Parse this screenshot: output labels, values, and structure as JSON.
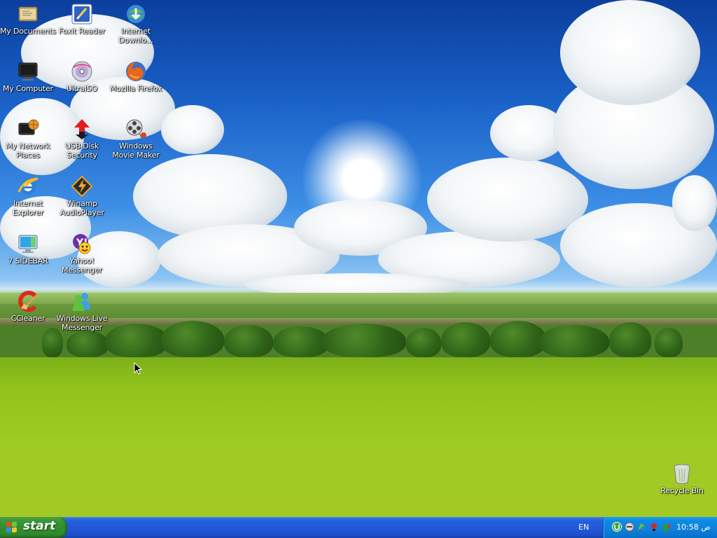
{
  "desktop": {
    "icons": [
      {
        "label": "My Documents",
        "icon": "my-documents-icon"
      },
      {
        "label": "Foxit Reader",
        "icon": "foxit-reader-icon"
      },
      {
        "label": "Internet Downlo...",
        "icon": "internet-download-manager-icon"
      },
      {
        "label": "My Computer",
        "icon": "my-computer-icon"
      },
      {
        "label": "UltraISO",
        "icon": "ultraiso-icon"
      },
      {
        "label": "Mozilla Firefox",
        "icon": "firefox-icon"
      },
      {
        "label": "My Network Places",
        "icon": "network-places-icon"
      },
      {
        "label": "USB Disk Security",
        "icon": "usb-disk-security-icon"
      },
      {
        "label": "Windows Movie Maker",
        "icon": "movie-maker-icon"
      },
      {
        "label": "Internet Explorer",
        "icon": "internet-explorer-icon"
      },
      {
        "label": "Winamp AudioPlayer",
        "icon": "winamp-icon"
      },
      {
        "label": "7 SIDEBAR",
        "icon": "sidebar-icon"
      },
      {
        "label": "Yahoo! Messenger",
        "icon": "yahoo-messenger-icon"
      },
      {
        "label": "CCleaner",
        "icon": "ccleaner-icon"
      },
      {
        "label": "Windows Live Messenger",
        "icon": "live-messenger-icon"
      },
      {
        "label": "Recycle Bin",
        "icon": "recycle-bin-icon"
      }
    ]
  },
  "taskbar": {
    "start_label": "start",
    "language": "EN",
    "clock": "10:58 ص",
    "tray_icons": [
      "utorrent-icon",
      "network-icon",
      "usb-icon",
      "arrow-up-icon",
      "security-icon"
    ]
  },
  "colors": {
    "taskbar_blue": "#245edb",
    "start_green": "#31902f",
    "tray_blue": "#0d80dc"
  }
}
